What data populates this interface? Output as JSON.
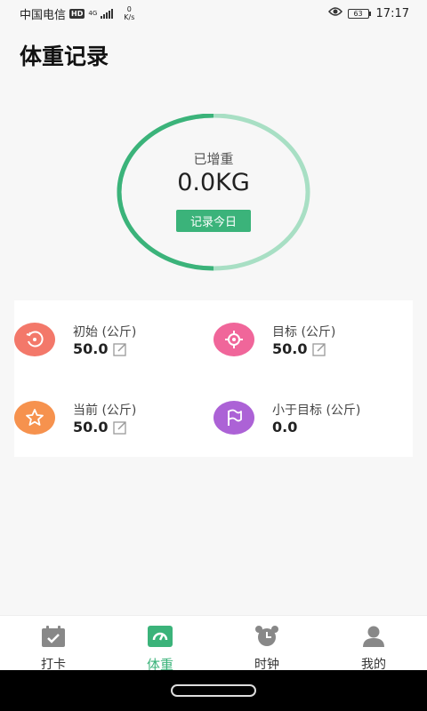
{
  "status_bar": {
    "carrier": "中国电信",
    "hd": "HD",
    "network": "4G",
    "speed_value": "0",
    "speed_unit": "K/s",
    "battery": "63",
    "time": "17:17"
  },
  "page_title": "体重记录",
  "ring": {
    "label": "已增重",
    "value": "0.0KG",
    "button": "记录今日",
    "progress_fraction": 0.5,
    "colors": {
      "done": "#3bb37a",
      "rest": "#a8dfc4"
    }
  },
  "stats": {
    "initial": {
      "label": "初始 (公斤)",
      "value": "50.0",
      "icon": "undo-icon",
      "color": "#f3786a"
    },
    "target": {
      "label": "目标 (公斤)",
      "value": "50.0",
      "icon": "target-icon",
      "color": "#f0669a"
    },
    "current": {
      "label": "当前 (公斤)",
      "value": "50.0",
      "icon": "star-icon",
      "color": "#f6924e"
    },
    "below_target": {
      "label": "小于目标 (公斤)",
      "value": "0.0",
      "icon": "flag-icon",
      "color": "#ac62d6"
    }
  },
  "tabs": [
    {
      "label": "打卡",
      "icon": "calendar-check-icon",
      "active": false
    },
    {
      "label": "体重",
      "icon": "scale-icon",
      "active": true
    },
    {
      "label": "时钟",
      "icon": "alarm-clock-icon",
      "active": false
    },
    {
      "label": "我的",
      "icon": "person-icon",
      "active": false
    }
  ],
  "accent_color": "#3bb37a"
}
